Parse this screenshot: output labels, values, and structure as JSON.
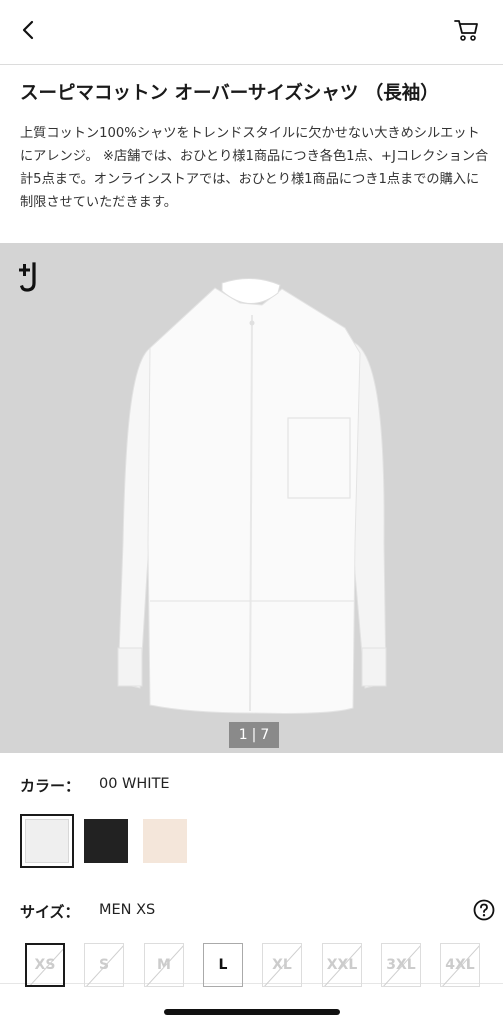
{
  "product": {
    "title": "スーピマコットン オーバーサイズシャツ （長袖）",
    "description": "上質コットン100%シャツをトレンドスタイルに欠かせない大きめシルエットにアレンジ。 ※店舗では、おひとり様1商品につき各色1点、+Jコレクション合計5点まで。オンラインストアでは、おひとり様1商品につき1点までの購入に制限させていただきます。"
  },
  "gallery": {
    "current_page": "1",
    "separator": "|",
    "total_pages": "7",
    "logo_icon": "plus-j-logo"
  },
  "color": {
    "label": "カラー：",
    "selected_value": "00 WHITE",
    "swatches": [
      {
        "name": "WHITE",
        "hex": "#efefef"
      },
      {
        "name": "BLACK",
        "hex": "#222222"
      },
      {
        "name": "NATURAL",
        "hex": "#f4e6da"
      }
    ]
  },
  "size": {
    "label": "サイズ：",
    "selected_value": "MEN XS",
    "options": [
      {
        "label": "XS",
        "available": false
      },
      {
        "label": "S",
        "available": false
      },
      {
        "label": "M",
        "available": false
      },
      {
        "label": "L",
        "available": true
      },
      {
        "label": "XL",
        "available": false
      },
      {
        "label": "XXL",
        "available": false
      },
      {
        "label": "3XL",
        "available": false
      },
      {
        "label": "4XL",
        "available": false
      }
    ]
  },
  "icons": {
    "back": "chevron-left-icon",
    "cart": "cart-icon",
    "help": "question-circle-icon"
  },
  "colors": {
    "gallery_bg": "#d4d4d4",
    "indicator_bg": "#8a8a8a",
    "text": "#1a1a1a"
  }
}
